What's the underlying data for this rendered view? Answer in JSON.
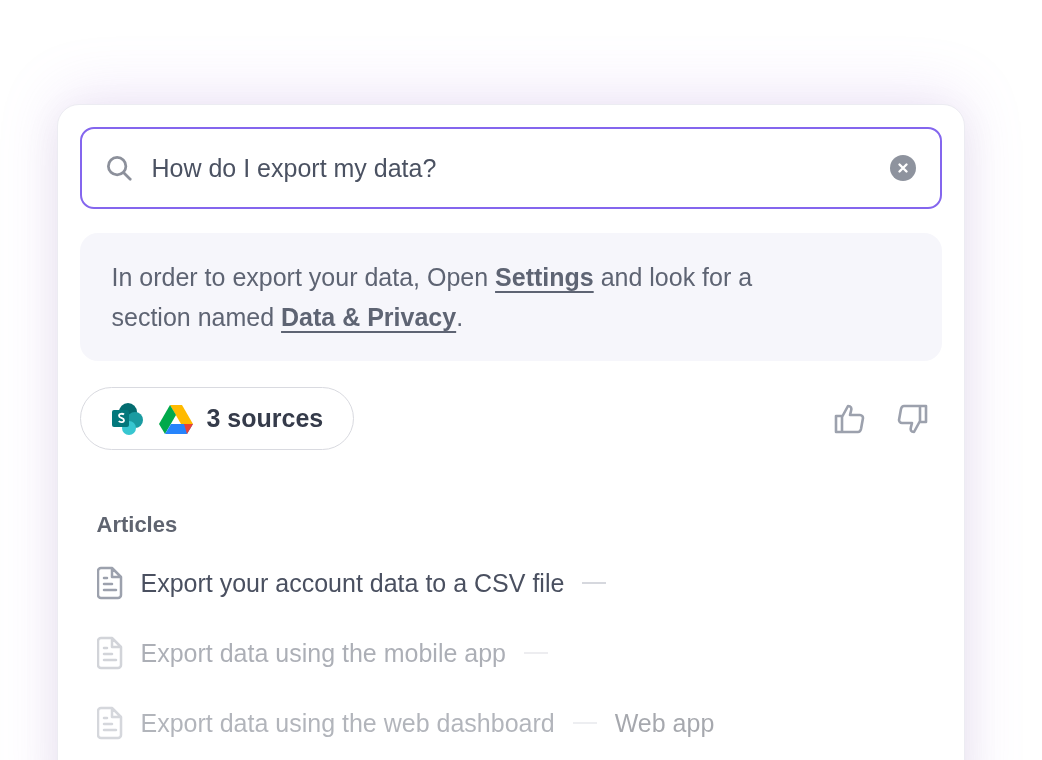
{
  "search": {
    "value": "How do I export my data?"
  },
  "answer": [
    {
      "kind": "text",
      "text": "In order to export your data, Open "
    },
    {
      "kind": "link",
      "text": "Settings"
    },
    {
      "kind": "text",
      "text": " and look for a section named "
    },
    {
      "kind": "link",
      "text": "Data & Privacy"
    },
    {
      "kind": "text",
      "text": "."
    }
  ],
  "sources": {
    "label": "3 sources"
  },
  "articles_heading": "Articles",
  "articles": [
    {
      "title": "Export your account data to a CSV file",
      "kind": "active"
    },
    {
      "title": "Export data using the mobile app",
      "kind": "muted"
    },
    {
      "title": "Export data using the web dashboard",
      "tag": "Web app",
      "kind": "faint"
    }
  ]
}
